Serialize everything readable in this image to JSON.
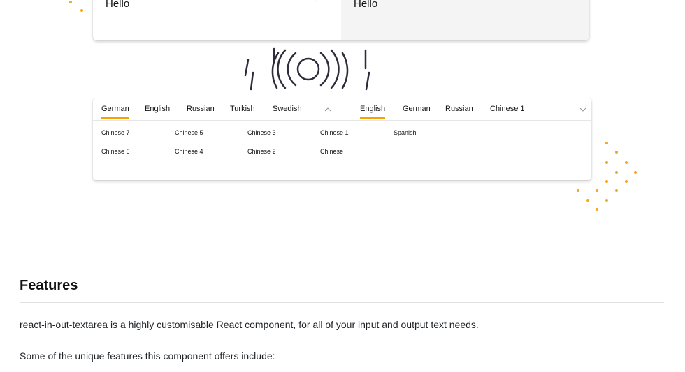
{
  "top_card": {
    "input_text": "Hello",
    "output_text": "Hello",
    "close_icon": "close-icon",
    "copy_icon": "copy-icon"
  },
  "logo": {
    "icon": "sound-wave-logo"
  },
  "tab_card": {
    "input_tabs": [
      "German",
      "English",
      "Russian",
      "Turkish",
      "Swedish"
    ],
    "output_tabs": [
      "English",
      "German",
      "Russian",
      "Chinese 1"
    ],
    "active_input_tab": "German",
    "active_output_tab": "English",
    "input_toggle_icon": "chevron-up-icon",
    "output_toggle_icon": "chevron-down-icon",
    "language_grid": {
      "row1": [
        "Chinese 7",
        "Chinese 5",
        "Chinese 3",
        "Chinese 1",
        "Spanish"
      ],
      "row2": [
        "Chinese 6",
        "Chinese 4",
        "Chinese 2",
        "Chinese"
      ]
    }
  },
  "readme": {
    "heading": "Features",
    "intro": "react-in-out-textarea is a highly customisable React component, for all of your input and output text needs.",
    "features_lead": "Some of the unique features this component offers include:"
  },
  "colors": {
    "accent": "#f5a623",
    "active_tab_underline": "#f4a300"
  }
}
